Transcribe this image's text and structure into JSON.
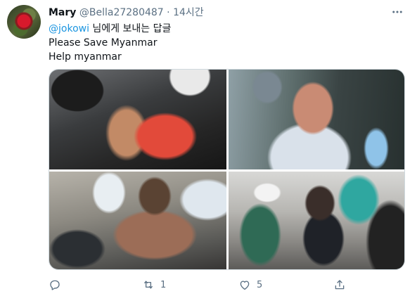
{
  "tweet": {
    "display_name": "Mary",
    "handle": "@Bella27280487",
    "separator": "·",
    "time": "14시간",
    "mention": "@jokowi",
    "reply_to_suffix": " 님에게 보내는 답글",
    "lines": [
      "Please Save Myanmar",
      "Help myanmar"
    ]
  },
  "actions": {
    "reply_count": "",
    "retweet_count": "1",
    "like_count": "5"
  },
  "icons": {
    "more": "more-icon",
    "reply": "reply-icon",
    "retweet": "retweet-icon",
    "like": "heart-icon",
    "share": "share-icon"
  },
  "colors": {
    "link": "#1b95e0",
    "muted": "#5b7083"
  }
}
